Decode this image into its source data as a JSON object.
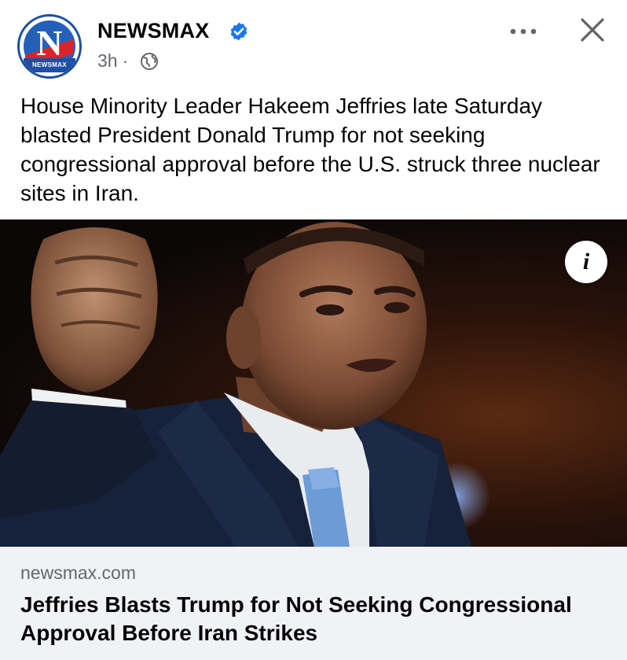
{
  "post": {
    "page_name": "NEWSMAX",
    "avatar_text": "NEWSMAX",
    "avatar_letter": "N",
    "timestamp": "3h",
    "separator": "·",
    "caption": "House Minority Leader Hakeem Jeffries late Saturday blasted President Donald Trump for not seeking congressional approval before the U.S. struck three nuclear sites in Iran.",
    "info_label": "i"
  },
  "link": {
    "domain": "newsmax.com",
    "title": "Jeffries Blasts Trump for Not Seeking Congressional Approval Before Iran Strikes"
  },
  "icons": {
    "verified": "verified-badge-icon",
    "audience": "globe-icon",
    "more": "more-options-icon",
    "close": "close-icon",
    "info": "info-icon"
  },
  "colors": {
    "verified_blue": "#1877f2",
    "secondary_text": "#65676b",
    "link_card_bg": "#f0f2f5",
    "brand_blue": "#1e4fa3",
    "brand_red": "#d9252a"
  }
}
